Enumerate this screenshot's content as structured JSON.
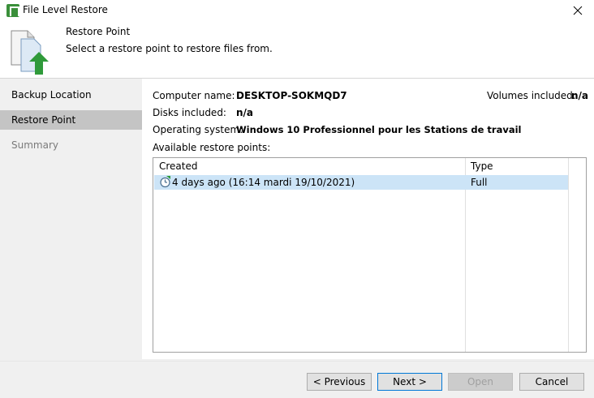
{
  "window": {
    "title": "File Level Restore",
    "close_icon": "close-icon"
  },
  "header": {
    "title": "Restore Point",
    "subtitle": "Select a restore point to restore files from."
  },
  "sidebar": {
    "items": [
      {
        "label": "Backup Location",
        "state": "normal"
      },
      {
        "label": "Restore Point",
        "state": "active"
      },
      {
        "label": "Summary",
        "state": "disabled"
      }
    ]
  },
  "info": {
    "computer_name_label": "Computer name:",
    "computer_name_value": "DESKTOP-SOKMQD7",
    "volumes_label": "Volumes included:",
    "volumes_value": "n/a",
    "disks_label": "Disks included:",
    "disks_value": "n/a",
    "os_label": "Operating system:",
    "os_value": "Windows 10 Professionnel pour les Stations de travail",
    "available_label": "Available restore points:"
  },
  "grid": {
    "columns": [
      "Created",
      "Type"
    ],
    "rows": [
      {
        "created": "4 days ago (16:14 mardi 19/10/2021)",
        "type": "Full",
        "icon": "clock-icon"
      }
    ]
  },
  "footer": {
    "previous": "< Previous",
    "next": "Next >",
    "open": "Open",
    "cancel": "Cancel"
  },
  "colors": {
    "selection": "#cce4f7",
    "accent_green": "#3a8f3a",
    "primary_border": "#0078d7"
  }
}
